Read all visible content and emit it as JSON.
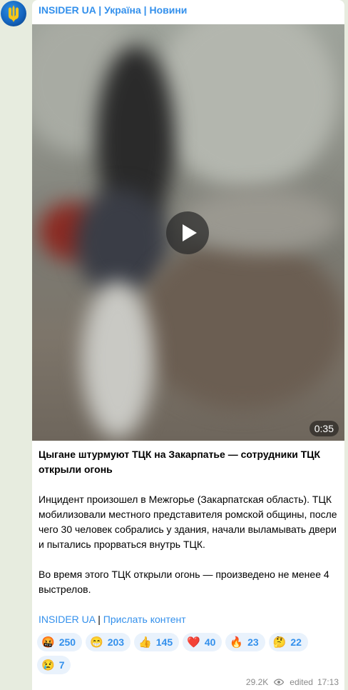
{
  "channel": {
    "name": "INSIDER UA | Україна | Новини"
  },
  "video": {
    "duration": "0:35"
  },
  "post": {
    "headline": "Цыгане штурмуют ТЦК на Закарпатье — сотрудники ТЦК открыли огонь",
    "paragraph1": "Инцидент произошел в Межгорье (Закарпатская область). ТЦК мобилизовали местного представителя ромской общины, после чего 30 человек собрались у здания, начали выламывать двери и пытались прорваться внутрь ТЦК.",
    "paragraph2": "Во время этого ТЦК открыли огонь — произведено не менее 4 выстрелов.",
    "link1": "INSIDER UA",
    "separator": "|",
    "link2": "Прислать контент"
  },
  "reactions": [
    {
      "emoji": "🤬",
      "count": "250"
    },
    {
      "emoji": "😁",
      "count": "203"
    },
    {
      "emoji": "👍",
      "count": "145"
    },
    {
      "emoji": "❤️",
      "count": "40"
    },
    {
      "emoji": "🔥",
      "count": "23"
    },
    {
      "emoji": "🤔",
      "count": "22"
    },
    {
      "emoji": "😢",
      "count": "7"
    }
  ],
  "meta": {
    "views": "29.2K",
    "edited_label": "edited",
    "time": "17:13"
  },
  "colors": {
    "accent": "#3390ec",
    "background": "#e7ecdf",
    "reaction_bg": "#e9f2fc"
  }
}
